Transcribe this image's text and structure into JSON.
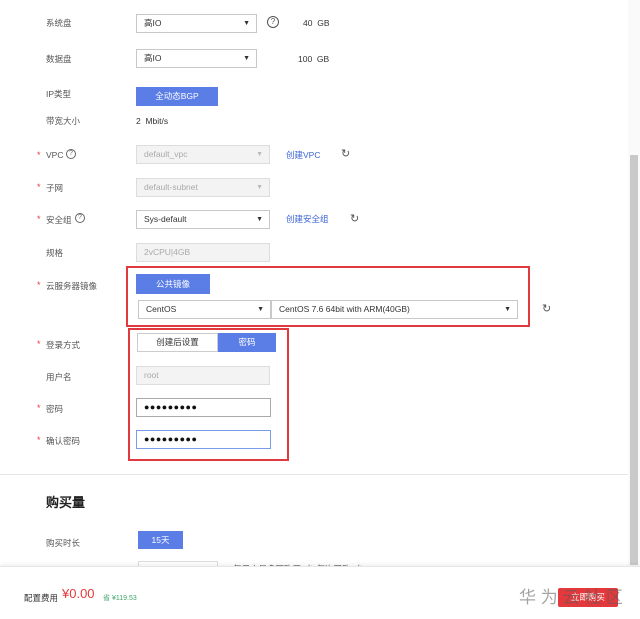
{
  "system_disk": {
    "label": "系统盘",
    "type": "高IO",
    "size": "40",
    "unit": "GB"
  },
  "data_disk": {
    "label": "数据盘",
    "type": "高IO",
    "size": "100",
    "unit": "GB"
  },
  "ip_type": {
    "label": "IP类型",
    "value": "全动态BGP"
  },
  "bandwidth": {
    "label": "带宽大小",
    "value": "2",
    "unit": "Mbit/s"
  },
  "vpc": {
    "label": "VPC",
    "value": "default_vpc",
    "link": "创建VPC"
  },
  "subnet": {
    "label": "子网",
    "value": "default-subnet"
  },
  "security_group": {
    "label": "安全组",
    "value": "Sys-default",
    "link": "创建安全组"
  },
  "spec": {
    "label": "规格",
    "value": "2vCPU|4GB"
  },
  "image": {
    "label": "云服务器镜像",
    "tab": "公共镜像",
    "os": "CentOS",
    "version": "CentOS 7.6 64bit with ARM(40GB)"
  },
  "login": {
    "label": "登录方式",
    "option_later": "创建后设置",
    "option_password": "密码"
  },
  "username": {
    "label": "用户名",
    "value": "root"
  },
  "password": {
    "label": "密码",
    "value": "●●●●●●●●●"
  },
  "confirm_password": {
    "label": "确认密码",
    "value": "●●●●●●●●●"
  },
  "purchase": {
    "heading": "购买量",
    "duration_label": "购买时长",
    "duration_value": "15天",
    "partial_text": "每用户最多可购买1台 每次限购1台"
  },
  "footer": {
    "fee_label": "配置费用",
    "price": "¥0.00",
    "original_price": "¥119.53",
    "save_label": "省",
    "buy_button": "立即购买",
    "watermark": "华 为 云 社 区"
  },
  "colors": {
    "accent": "#5a7de6",
    "highlight": "#e03a3e",
    "price": "#e4393c"
  }
}
